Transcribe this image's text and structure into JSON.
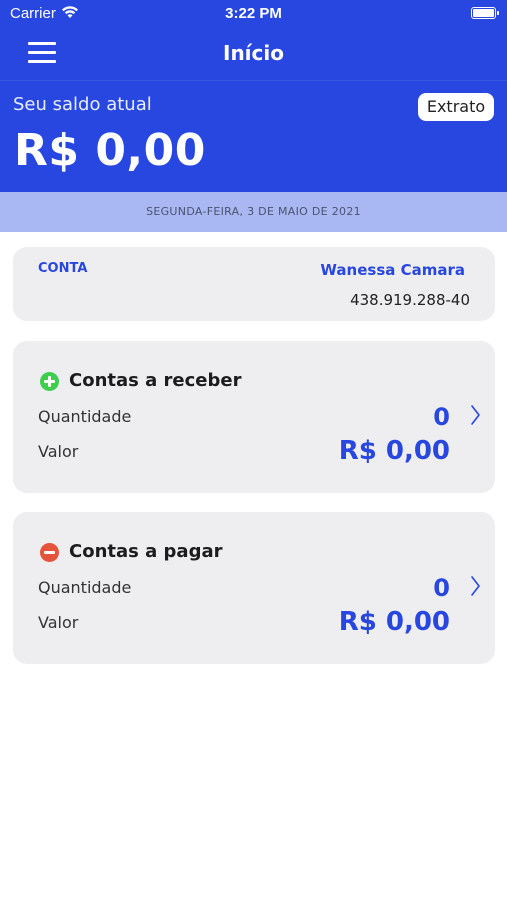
{
  "status_bar": {
    "carrier": "Carrier",
    "time": "3:22 PM"
  },
  "nav": {
    "title": "Início",
    "menu_icon": "hamburger-menu-icon"
  },
  "balance": {
    "label": "Seu saldo atual",
    "value": "R$ 0,00",
    "extrato_label": "Extrato"
  },
  "date": "SEGUNDA-FEIRA, 3 DE MAIO DE 2021",
  "account": {
    "label": "CONTA",
    "name": "Wanessa Camara",
    "document": "438.919.288-40"
  },
  "receivables": {
    "title": "Contas a receber",
    "icon": "plus-circle-icon",
    "quantity_label": "Quantidade",
    "quantity": "0",
    "value_label": "Valor",
    "value": "R$ 0,00"
  },
  "payables": {
    "title": "Contas a pagar",
    "icon": "minus-circle-icon",
    "quantity_label": "Quantidade",
    "quantity": "0",
    "value_label": "Valor",
    "value": "R$ 0,00"
  },
  "colors": {
    "primary": "#2747e0",
    "date_band": "#a9b8f3",
    "card_bg": "#eeedef",
    "plus_green": "#3ccf4e",
    "minus_red": "#e5533a"
  }
}
